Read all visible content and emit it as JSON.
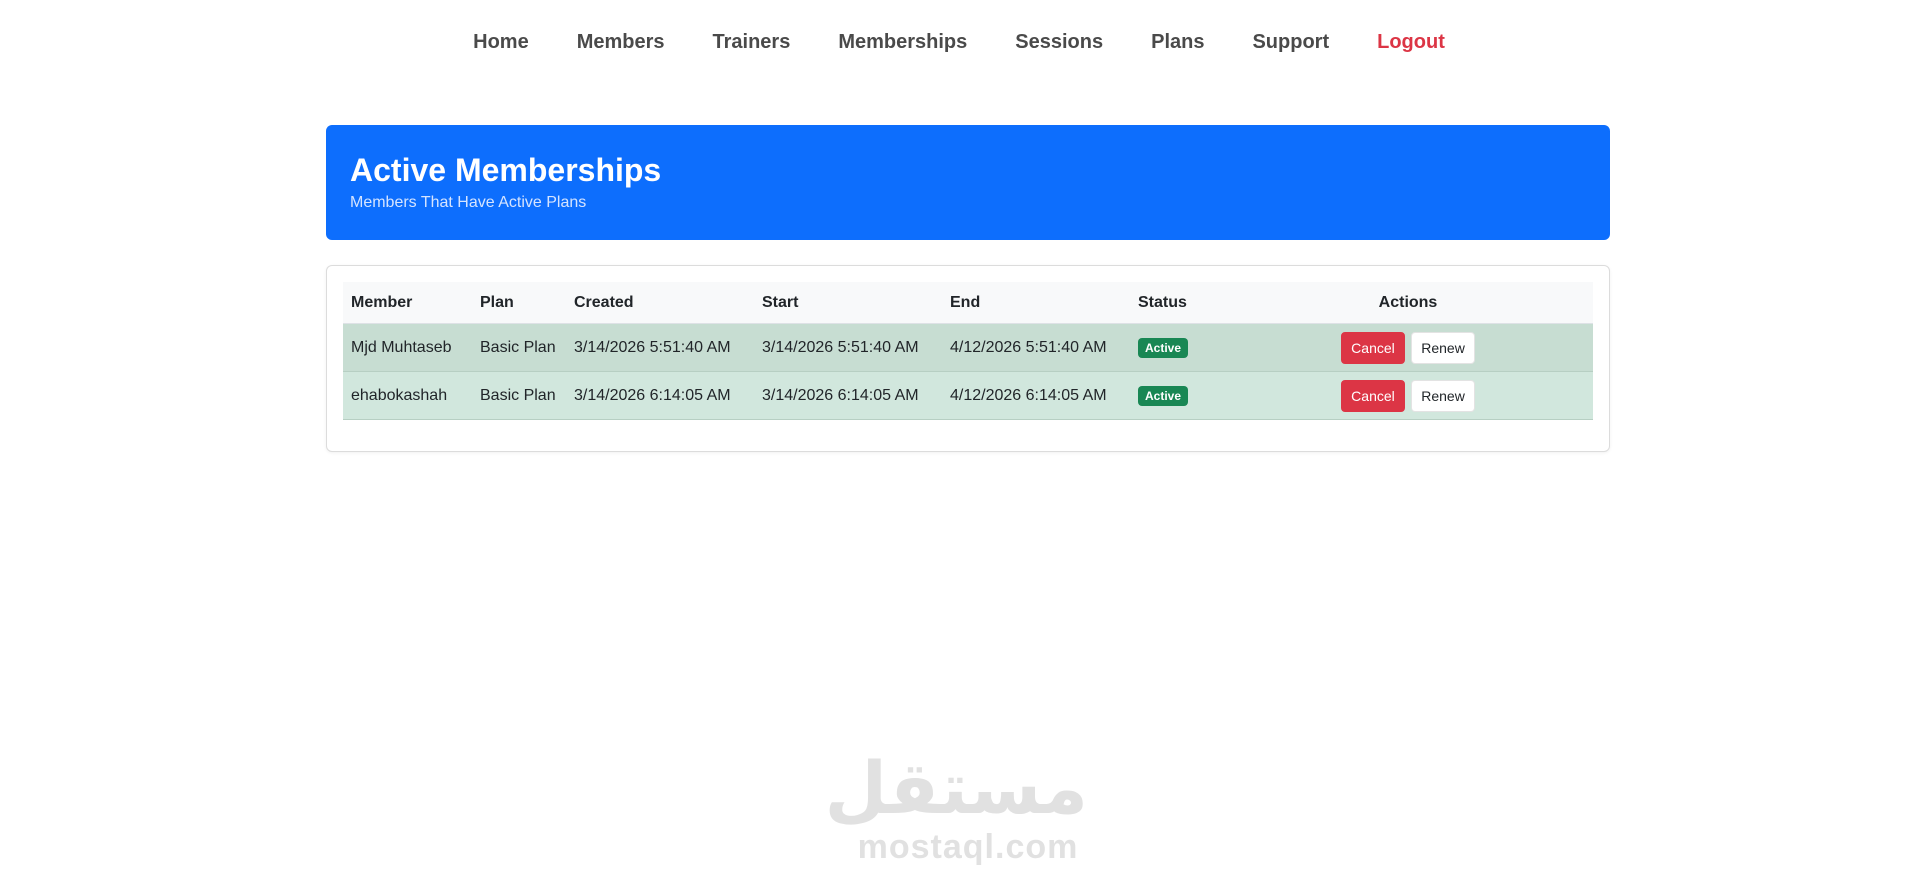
{
  "nav": {
    "items": [
      {
        "label": "Home"
      },
      {
        "label": "Members"
      },
      {
        "label": "Trainers"
      },
      {
        "label": "Memberships"
      },
      {
        "label": "Sessions"
      },
      {
        "label": "Plans"
      },
      {
        "label": "Support"
      },
      {
        "label": "Logout",
        "color": "#dc3545"
      }
    ]
  },
  "hero": {
    "title": "Active Memberships",
    "subtitle": "Members That Have Active Plans",
    "background": "#0d6efd"
  },
  "table": {
    "headers": [
      "Member",
      "Plan",
      "Created",
      "Start",
      "End",
      "Status",
      "Actions"
    ],
    "rows": [
      {
        "member": "Mjd Muhtaseb",
        "plan": "Basic Plan",
        "created": "3/14/2026 5:51:40 AM",
        "start": "3/14/2026 5:51:40 AM",
        "end": "4/12/2026 5:51:40 AM",
        "status": "Active",
        "cancel_label": "Cancel",
        "renew_label": "Renew"
      },
      {
        "member": "ehabokashah",
        "plan": "Basic Plan",
        "created": "3/14/2026 6:14:05 AM",
        "start": "3/14/2026 6:14:05 AM",
        "end": "4/12/2026 6:14:05 AM",
        "status": "Active",
        "cancel_label": "Cancel",
        "renew_label": "Renew"
      }
    ]
  },
  "colors": {
    "badge_active": "#198754",
    "cancel_button": "#dc3545",
    "row_success": "#d1e7dd"
  },
  "watermark": {
    "arabic": "مستقل",
    "latin": "mostaql.com"
  }
}
